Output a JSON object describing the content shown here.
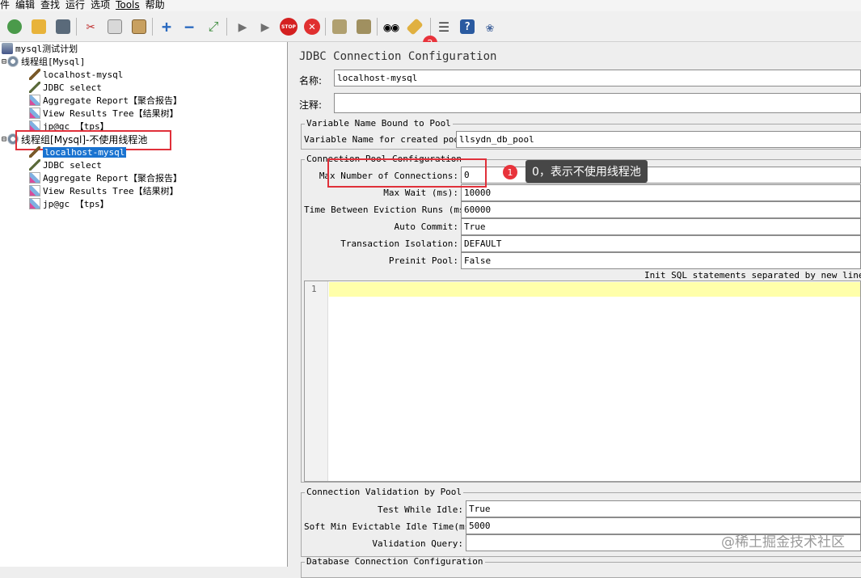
{
  "menu": [
    "件",
    "编辑",
    "查找",
    "运行",
    "选项",
    "Tools",
    "帮助"
  ],
  "toolbar": {
    "badge": "2"
  },
  "tree": {
    "plan": "mysql测试计划",
    "group1": "线程组[Mysql]",
    "g1_items": [
      "localhost-mysql",
      "JDBC select",
      "Aggregate Report【聚合报告】",
      "View Results Tree【结果树】",
      "jp@gc 【tps】"
    ],
    "group2": "线程组[Mysql]-不使用线程池",
    "g2_items": [
      "localhost-mysql",
      "JDBC select",
      "Aggregate Report【聚合报告】",
      "View Results Tree【结果树】",
      "jp@gc 【tps】"
    ]
  },
  "panel": {
    "title": "JDBC Connection Configuration",
    "name_label": "名称:",
    "name_value": "localhost-mysql",
    "comment_label": "注释:",
    "comment_value": "",
    "var_group": "Variable Name Bound to Pool",
    "var_label": "Variable Name for created pool:",
    "var_value": "llsydn_db_pool",
    "pool_group": "Connection Pool Configuration",
    "pool_fields": [
      {
        "label": "Max Number of Connections:",
        "value": "0"
      },
      {
        "label": "Max Wait (ms):",
        "value": "10000"
      },
      {
        "label": "Time Between Eviction Runs (ms):",
        "value": "60000"
      },
      {
        "label": "Auto Commit:",
        "value": "True"
      },
      {
        "label": "Transaction Isolation:",
        "value": "DEFAULT"
      },
      {
        "label": "Preinit Pool:",
        "value": "False"
      }
    ],
    "init_sql_label": "Init SQL statements separated by new line:",
    "line_number": "1",
    "validation_group": "Connection Validation by Pool",
    "validation_fields": [
      {
        "label": "Test While Idle:",
        "value": "True"
      },
      {
        "label": "Soft Min Evictable Idle Time(ms):",
        "value": "5000"
      },
      {
        "label": "Validation Query:",
        "value": ""
      }
    ],
    "db_group": "Database Connection Configuration"
  },
  "annotation": {
    "badge": "1",
    "tooltip": "0，表示不使用线程池"
  },
  "watermark": "@稀土掘金技术社区"
}
